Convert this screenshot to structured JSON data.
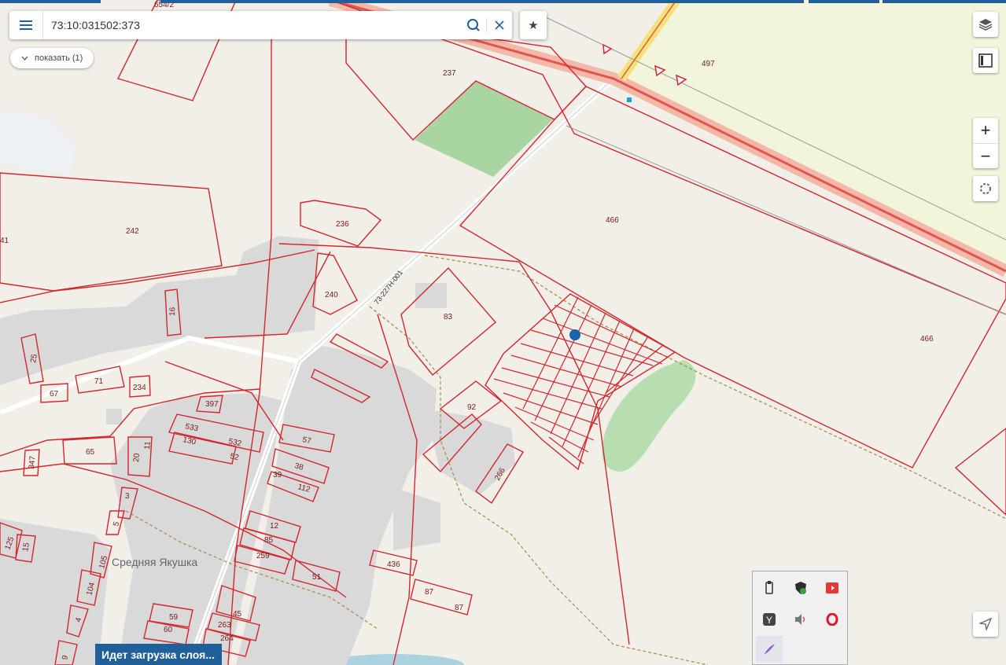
{
  "search": {
    "value": "73:10:031502:373"
  },
  "show_button": {
    "label": "показать (1)"
  },
  "status": {
    "label": "Идет загрузка слоя..."
  },
  "map": {
    "place_name": "Средняя Якушка",
    "road_label": "73-227Н-001",
    "parcel_numbers": [
      "654/2",
      "237",
      "497",
      "466",
      "466",
      "242",
      "236",
      "240",
      "83",
      "16",
      "25",
      "71",
      "67",
      "234",
      "397",
      "533",
      "532",
      "130",
      "52",
      "57",
      "38",
      "39",
      "112",
      "92",
      "266",
      "65",
      "347",
      "20",
      "11",
      "3",
      "5",
      "125",
      "15",
      "105",
      "104",
      "4",
      "9",
      "12",
      "85",
      "259",
      "51",
      "436",
      "87",
      "87",
      "59",
      "60",
      "45",
      "263",
      "264",
      "41"
    ]
  },
  "colors": {
    "parcel": "#d4262d",
    "background": "#f2efe9",
    "building": "#d9d9d9",
    "forest": "#a8d5a2",
    "field": "#f3f4dc",
    "water": "#aad3df",
    "accent": "#1f5f9a",
    "marker": "#1565a8"
  },
  "tray": {
    "icons": [
      "usb-icon",
      "shield-icon",
      "media-icon",
      "yandex-icon",
      "volume-icon",
      "opera-icon",
      "pen-icon"
    ]
  }
}
